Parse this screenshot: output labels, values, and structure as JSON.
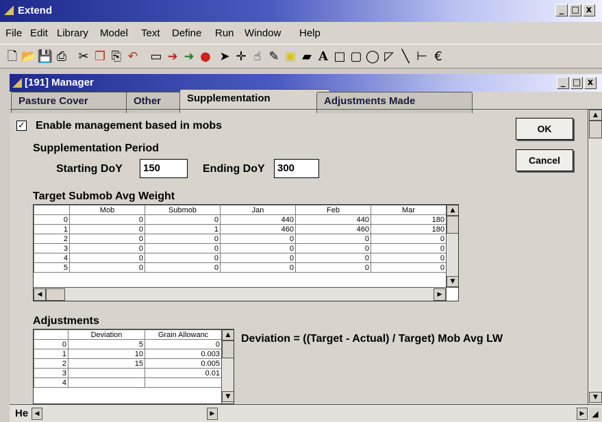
{
  "app": {
    "title": "Extend",
    "controls": [
      "_",
      "□",
      "x"
    ]
  },
  "menu": [
    "File",
    "Edit",
    "Library",
    "Model",
    "Text",
    "Define",
    "Run",
    "Window",
    "Help"
  ],
  "toolbar_icons": [
    "new-document-icon",
    "open-folder-icon",
    "save-icon",
    "print-icon",
    "cut-icon",
    "copy-icon",
    "paste-icon",
    "undo-icon",
    "block-icon",
    "connect-icon",
    "run-icon",
    "stop-icon",
    "pointer-icon",
    "crosshair-icon",
    "hand-icon",
    "pencil-icon",
    "color-icon",
    "fill-icon",
    "text-tool-icon",
    "rectangle-icon",
    "rounded-rect-icon",
    "oval-icon",
    "polygon-icon",
    "line-icon",
    "connector-icon",
    "currency-icon"
  ],
  "manager": {
    "title": "[191]  Manager",
    "controls": [
      "_",
      "□",
      "x"
    ]
  },
  "tabs": [
    "Pasture Cover",
    "Other",
    "Supplementation",
    "Adjustments Made"
  ],
  "active_tab": "Supplementation",
  "enable_label": "Enable management based in mobs",
  "enable_checked": true,
  "period": {
    "heading": "Supplementation Period",
    "start_label": "Starting DoY",
    "start_value": "150",
    "end_label": "Ending DoY",
    "end_value": "300"
  },
  "buttons": {
    "ok": "OK",
    "cancel": "Cancel"
  },
  "target_table": {
    "heading": "Target Submob Avg Weight",
    "columns": [
      "Mob",
      "Submob",
      "Jan",
      "Feb",
      "Mar"
    ],
    "rows": [
      {
        "n": "0",
        "cells": [
          "0",
          "0",
          "440",
          "440",
          "180"
        ]
      },
      {
        "n": "1",
        "cells": [
          "0",
          "1",
          "460",
          "460",
          "180"
        ]
      },
      {
        "n": "2",
        "cells": [
          "0",
          "0",
          "0",
          "0",
          "0"
        ]
      },
      {
        "n": "3",
        "cells": [
          "0",
          "0",
          "0",
          "0",
          "0"
        ]
      },
      {
        "n": "4",
        "cells": [
          "0",
          "0",
          "0",
          "0",
          "0"
        ]
      },
      {
        "n": "5",
        "cells": [
          "0",
          "0",
          "0",
          "0",
          "0"
        ]
      }
    ]
  },
  "adjust_table": {
    "heading": "Adjustments",
    "columns": [
      "Deviation",
      "Grain Allowanc"
    ],
    "rows": [
      {
        "n": "0",
        "cells": [
          "5",
          "0"
        ]
      },
      {
        "n": "1",
        "cells": [
          "10",
          "0.003"
        ]
      },
      {
        "n": "2",
        "cells": [
          "15",
          "0.005"
        ]
      },
      {
        "n": "3",
        "cells": [
          "",
          "0.01"
        ]
      },
      {
        "n": "4",
        "cells": [
          "",
          ""
        ]
      }
    ]
  },
  "formula": "Deviation = ((Target - Actual) / Target) Mob Avg LW",
  "status": "He"
}
